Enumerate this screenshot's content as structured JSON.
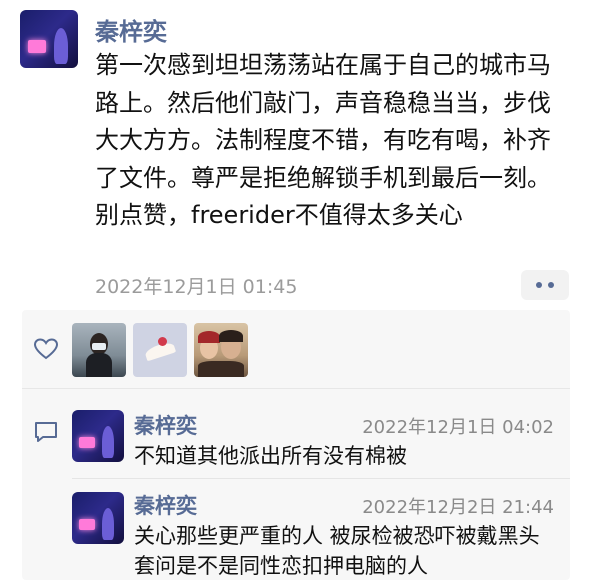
{
  "post": {
    "author": "秦梓奕",
    "text": "第一次感到坦坦荡荡站在属于自己的城市马路上。然后他们敲门，声音稳稳当当，步伐大大方方。法制程度不错，有吃有喝，补齐了文件。尊严是拒绝解锁手机到最后一刻。别点赞，freerider不值得太多关心",
    "time": "2022年12月1日 01:45"
  },
  "likes": {
    "icon": "heart-icon",
    "avatars": [
      "liked-user-1",
      "liked-user-2",
      "liked-user-3"
    ]
  },
  "comments": [
    {
      "author": "秦梓奕",
      "time": "2022年12月1日 04:02",
      "text": "不知道其他派出所有没有棉被"
    },
    {
      "author": "秦梓奕",
      "time": "2022年12月2日 21:44",
      "text": "关心那些更严重的人 被尿检被恐吓被戴黑头套问是不是同性恋扣押电脑的人"
    }
  ],
  "colors": {
    "name": "#576b95",
    "text": "#111111",
    "meta": "#9b9b9b",
    "panel": "#f7f7f7"
  }
}
